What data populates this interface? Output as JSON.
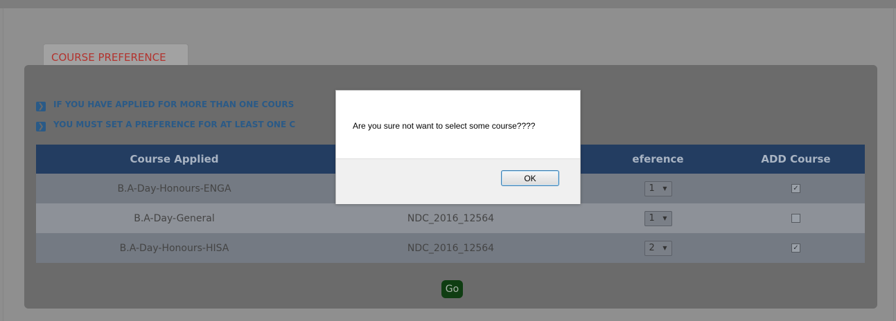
{
  "tab": {
    "label": "COURSE PREFERENCE"
  },
  "notices": [
    "IF YOU HAVE APPLIED FOR MORE THAN ONE COURS",
    "YOU MUST SET A PREFERENCE FOR AT LEAST ONE C"
  ],
  "table": {
    "headers": [
      "Course Applied",
      "",
      "eference",
      "ADD Course"
    ],
    "rows": [
      {
        "course": "B.A-Day-Honours-ENGA",
        "application_no": "",
        "preference": "1",
        "add_course": true
      },
      {
        "course": "B.A-Day-General",
        "application_no": "NDC_2016_12564",
        "preference": "1",
        "add_course": false
      },
      {
        "course": "B.A-Day-Honours-HISA",
        "application_no": "NDC_2016_12564",
        "preference": "2",
        "add_course": true
      }
    ]
  },
  "go_button": {
    "label": "Go"
  },
  "dialog": {
    "message": "Are you sure not want to select some course????",
    "ok_label": "OK"
  },
  "colors": {
    "header_bg": "#233d61",
    "notice_text": "#2a5a87",
    "tab_text": "#b2332e",
    "go_button": "#0f3d12",
    "dialog_button_border": "#3c7fb1"
  },
  "icons": {
    "notice_bullet": "chevron-right-icon",
    "dropdown": "caret-down-icon",
    "checkbox_checked": "checkmark-icon"
  }
}
